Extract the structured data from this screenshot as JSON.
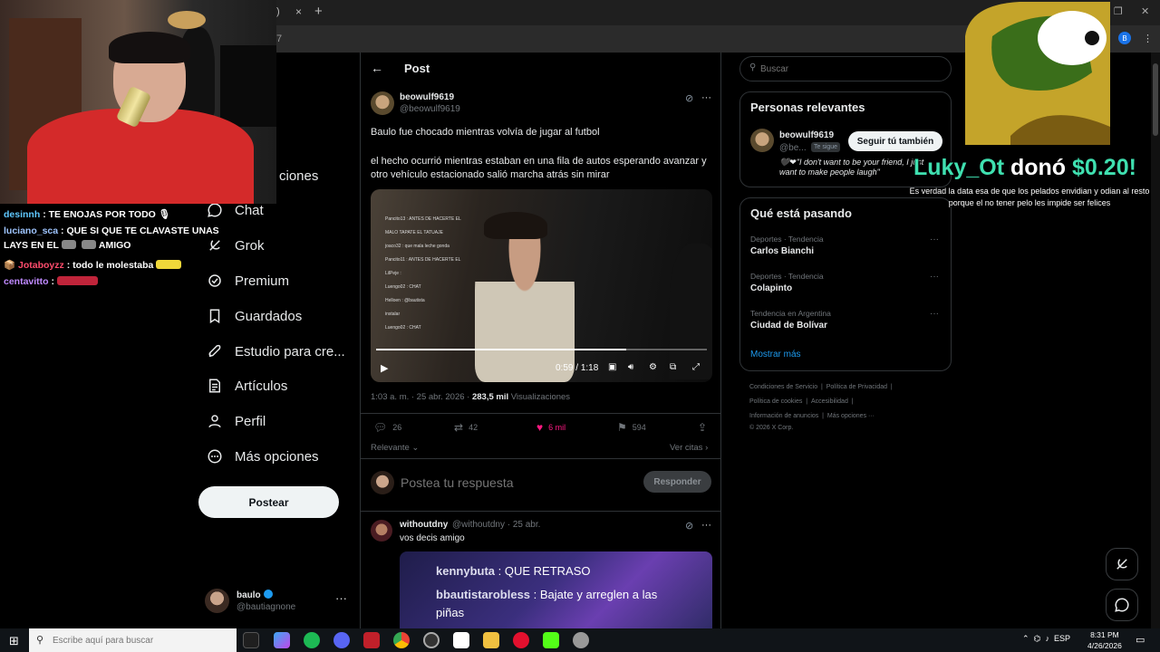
{
  "browser": {
    "tab_close": "×",
    "tab_new": "+",
    "tab_fragment": ")",
    "url_fragment": "7",
    "profile_initial": "B"
  },
  "nav": {
    "items": [
      {
        "label": "Chat",
        "icon": "chat-icon"
      },
      {
        "label": "Grok",
        "icon": "grok-icon"
      },
      {
        "label": "Premium",
        "icon": "premium-icon"
      },
      {
        "label": "Guardados",
        "icon": "bookmark-icon"
      },
      {
        "label": "Estudio para cre...",
        "icon": "rocket-icon"
      },
      {
        "label": "Artículos",
        "icon": "article-icon"
      },
      {
        "label": "Perfil",
        "icon": "person-icon"
      },
      {
        "label": "Más opciones",
        "icon": "more-icon"
      }
    ],
    "partial_label": "ciones",
    "post_button": "Postear",
    "account": {
      "name": "baulo",
      "handle": "@bautiagnone",
      "more": "···"
    }
  },
  "post": {
    "header_title": "Post",
    "author_name": "beowulf9619",
    "author_handle": "@beowulf9619",
    "more": "···",
    "text_title": "Baulo fue chocado mientras volvía de jugar al futbol",
    "text_body": "el hecho ocurrió mientras estaban en una fila de autos esperando avanzar y otro vehículo estacionado salió marcha atrás sin mirar",
    "video": {
      "current_time": "0:59",
      "duration": "1:18",
      "progress": 0.756,
      "overlay_chat": [
        "Pancito13 : ANTES DE HACERTE EL",
        "MALO TAPATE EL TATUAJE",
        "joaco32 : que mala leche gonda",
        "Pancito11 : ANTES DE HACERTE EL",
        "LilPeje :",
        "Luengo02 : CHAT",
        "Helloen : @bautista",
        "instalar",
        "Luengo02 : CHAT"
      ]
    },
    "meta_time": "1:03 a. m. · 25 abr. 2026 ·",
    "meta_views": "283,5 mil",
    "meta_views_label": "Visualizaciones",
    "stats": {
      "replies": "26",
      "reposts": "42",
      "likes": "6 mil",
      "bookmarks": "594"
    },
    "relevance_label": "Relevante",
    "quotes_label": "Ver citas",
    "reply_placeholder": "Postea tu respuesta",
    "reply_button": "Responder"
  },
  "comment": {
    "name": "withoutdny",
    "handle": "@withoutdny · 25 abr.",
    "text": "vos decis amigo",
    "media_lines": [
      {
        "user": "kennybuta",
        "msg": "QUE RETRASO"
      },
      {
        "user": "bbautistarobless",
        "msg": "Bajate y arreglen a las"
      },
      {
        "user": "",
        "msg": "piñas"
      }
    ]
  },
  "sidebar": {
    "search_placeholder": "Buscar",
    "relevant_title": "Personas relevantes",
    "relevant": {
      "name": "beowulf9619",
      "handle": "@be...",
      "badge": "Te sigue",
      "follow_button": "Seguir tú también",
      "bio": "🖤❤\"I don't want to be your friend, I just want to make people laugh\""
    },
    "trends_title": "Qué está pasando",
    "trends": [
      {
        "category": "Deportes · Tendencia",
        "name": "Carlos Bianchi"
      },
      {
        "category": "Deportes · Tendencia",
        "name": "Colapinto"
      },
      {
        "category": "Tendencia en Argentina",
        "name": "Ciudad de Bolívar"
      }
    ],
    "show_more": "Mostrar más",
    "footer": {
      "line1": [
        "Condiciones de Servicio",
        "Política de Privacidad"
      ],
      "line2": [
        "Política de cookies",
        "Accesibilidad"
      ],
      "line3": [
        "Información de anuncios",
        "Más opciones ···"
      ],
      "copyright": "© 2026 X Corp."
    }
  },
  "stream": {
    "chat": [
      {
        "user": "desinnh",
        "text": ": TE ENOJAS POR TODO"
      },
      {
        "user": "luciano_sca",
        "text": ": QUE SI QUE TE CLAVASTE UNAS"
      },
      {
        "user": "",
        "text": "LAYS EN EL"
      },
      {
        "user": "",
        "text": "AMIGO"
      },
      {
        "user": "Jotaboyzz",
        "text": ": todo le molestaba"
      },
      {
        "user": "centavitto",
        "text": ":"
      }
    ],
    "donation": {
      "donor": "Luky_Ot",
      "verb": "donó",
      "amount": "$0.20!",
      "message": "Es verdad la data esa de que los pelados envidian y odian al resto porque el no tener pelo les impide ser felices"
    }
  },
  "taskbar": {
    "search_placeholder": "Escribe aquí para buscar",
    "tray_lang": "ESP",
    "time": "8:31 PM",
    "date": "4/26/2026"
  }
}
